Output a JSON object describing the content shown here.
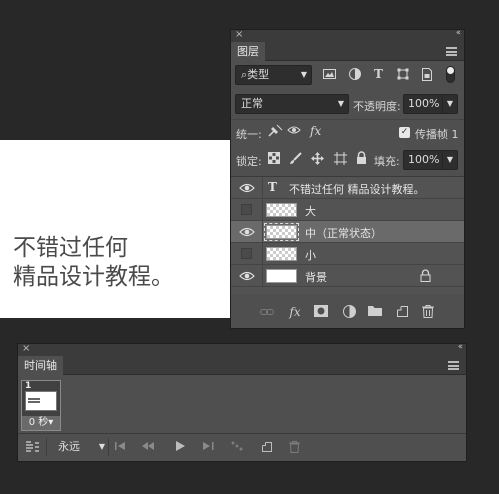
{
  "canvas": {
    "text_line1": "不错过任何",
    "text_line2": "精品设计教程。"
  },
  "layers_panel": {
    "close": "×",
    "collapse": "‹‹",
    "tab": "图层",
    "filter": {
      "icon": "⌕",
      "value": "类型"
    },
    "filter_icons": [
      "image-filter-icon",
      "adjustment-filter-icon",
      "type-filter-icon",
      "shape-filter-icon",
      "smart-object-filter-icon"
    ],
    "blend_mode": "正常",
    "opacity_label": "不透明度:",
    "opacity_value": "100%",
    "unify_label": "统一:",
    "propagate_label": "传播帧 1",
    "lock_label": "锁定:",
    "fill_label": "填充:",
    "fill_value": "100%",
    "type_glyph": "T",
    "layers": [
      {
        "name": "不错过任何 精品设计教程。",
        "visible": true,
        "kind": "text"
      },
      {
        "name": "大",
        "visible": false,
        "kind": "pixel"
      },
      {
        "name": "中（正常状态）",
        "visible": true,
        "kind": "pixel",
        "selected": true
      },
      {
        "name": "小",
        "visible": false,
        "kind": "pixel"
      },
      {
        "name": "背景",
        "visible": true,
        "kind": "background",
        "locked": true
      }
    ],
    "footer_icons": [
      "link-icon",
      "fx-icon",
      "mask-icon",
      "adjustment-layer-icon",
      "group-folder-icon",
      "new-layer-icon",
      "delete-icon"
    ],
    "fx_label": "fx"
  },
  "timeline_panel": {
    "close": "×",
    "collapse": "‹‹",
    "tab": "时间轴",
    "frame": {
      "number": "1",
      "delay": "0 秒"
    },
    "loop": "永远",
    "controls": [
      "convert-icon",
      "first-frame-icon",
      "previous-frame-icon",
      "play-icon",
      "next-frame-icon",
      "tween-icon",
      "duplicate-frame-icon",
      "delete-frame-icon"
    ]
  },
  "colors": {
    "workspace": "#282828",
    "panel": "#4f4f4f",
    "selected_layer": "#6a6a6a"
  }
}
